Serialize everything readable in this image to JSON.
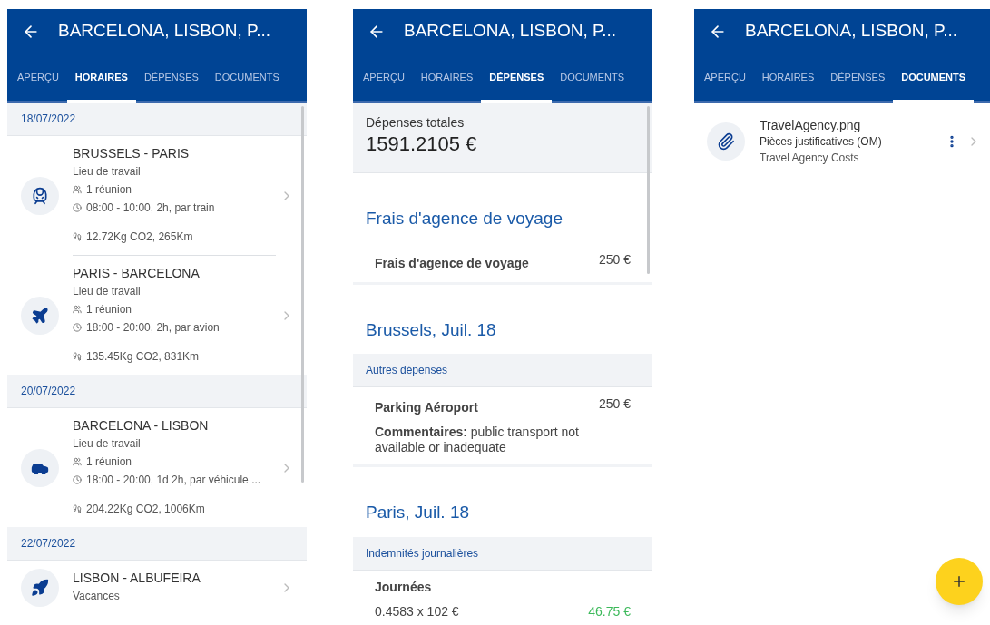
{
  "screens": [
    {
      "kind": "schedule",
      "title": "BARCELONA, LISBON, P...",
      "tabs": [
        {
          "label": "APERÇU",
          "selected": false
        },
        {
          "label": "HORAIRES",
          "selected": true
        },
        {
          "label": "DÉPENSES",
          "selected": false
        },
        {
          "label": "DOCUMENTS",
          "selected": false
        }
      ],
      "days": [
        {
          "date": "18/07/2022",
          "trips": [
            {
              "kind": "train",
              "route": "BRUSSELS - PARIS",
              "purpose": "Lieu de travail",
              "meetings": "1 réunion",
              "time": "08:00 - 10:00, 2h, par train",
              "emissions": "12.72Kg CO2, 265Km"
            },
            {
              "kind": "plane",
              "route": "PARIS - BARCELONA",
              "purpose": "Lieu de travail",
              "meetings": "1 réunion",
              "time": "18:00 - 20:00, 2h, par avion",
              "emissions": "135.45Kg CO2, 831Km"
            }
          ]
        },
        {
          "date": "20/07/2022",
          "trips": [
            {
              "kind": "car",
              "route": "BARCELONA - LISBON",
              "purpose": "Lieu de travail",
              "meetings": "1 réunion",
              "time": "18:00 - 20:00, 1d 2h, par véhicule ...",
              "emissions": "204.22Kg CO2, 1006Km"
            }
          ]
        },
        {
          "date": "22/07/2022",
          "trips": [
            {
              "kind": "rocket",
              "route": "LISBON - ALBUFEIRA",
              "purpose": "Vacances"
            }
          ]
        }
      ]
    },
    {
      "kind": "expenses",
      "title": "BARCELONA, LISBON, P...",
      "tabs": [
        {
          "label": "APERÇU",
          "selected": false
        },
        {
          "label": "HORAIRES",
          "selected": false
        },
        {
          "label": "DÉPENSES",
          "selected": true
        },
        {
          "label": "DOCUMENTS",
          "selected": false
        }
      ],
      "total_label": "Dépenses totales",
      "total": "1591.2105 €",
      "sections": [
        {
          "title": "Frais d'agence de voyage",
          "items": [
            {
              "kind": "expense",
              "name": "Frais d'agence de voyage",
              "amount": "250 €"
            }
          ]
        },
        {
          "title": "Brussels, Juil. 18",
          "category": "Autres dépenses",
          "items": [
            {
              "kind": "expense",
              "name": "Parking Aéroport",
              "amount": "250 €",
              "comment": "**Commentaires:** public transport not available or inadequate"
            }
          ]
        },
        {
          "title": "Paris, Juil. 18",
          "category": "Indemnités journalières",
          "items": [
            {
              "kind": "allowance",
              "name": "Journées",
              "formula": "0.4583 x 102 €",
              "amount": "46.75 €"
            }
          ]
        }
      ]
    },
    {
      "kind": "documents",
      "title": "BARCELONA, LISBON, P...",
      "tabs": [
        {
          "label": "APERÇU",
          "selected": false
        },
        {
          "label": "HORAIRES",
          "selected": false
        },
        {
          "label": "DÉPENSES",
          "selected": false
        },
        {
          "label": "DOCUMENTS",
          "selected": true
        }
      ],
      "documents": [
        {
          "name": "TravelAgency.png",
          "type": "Pièces justificatives (OM)",
          "description": "Travel Agency Costs"
        }
      ]
    }
  ]
}
